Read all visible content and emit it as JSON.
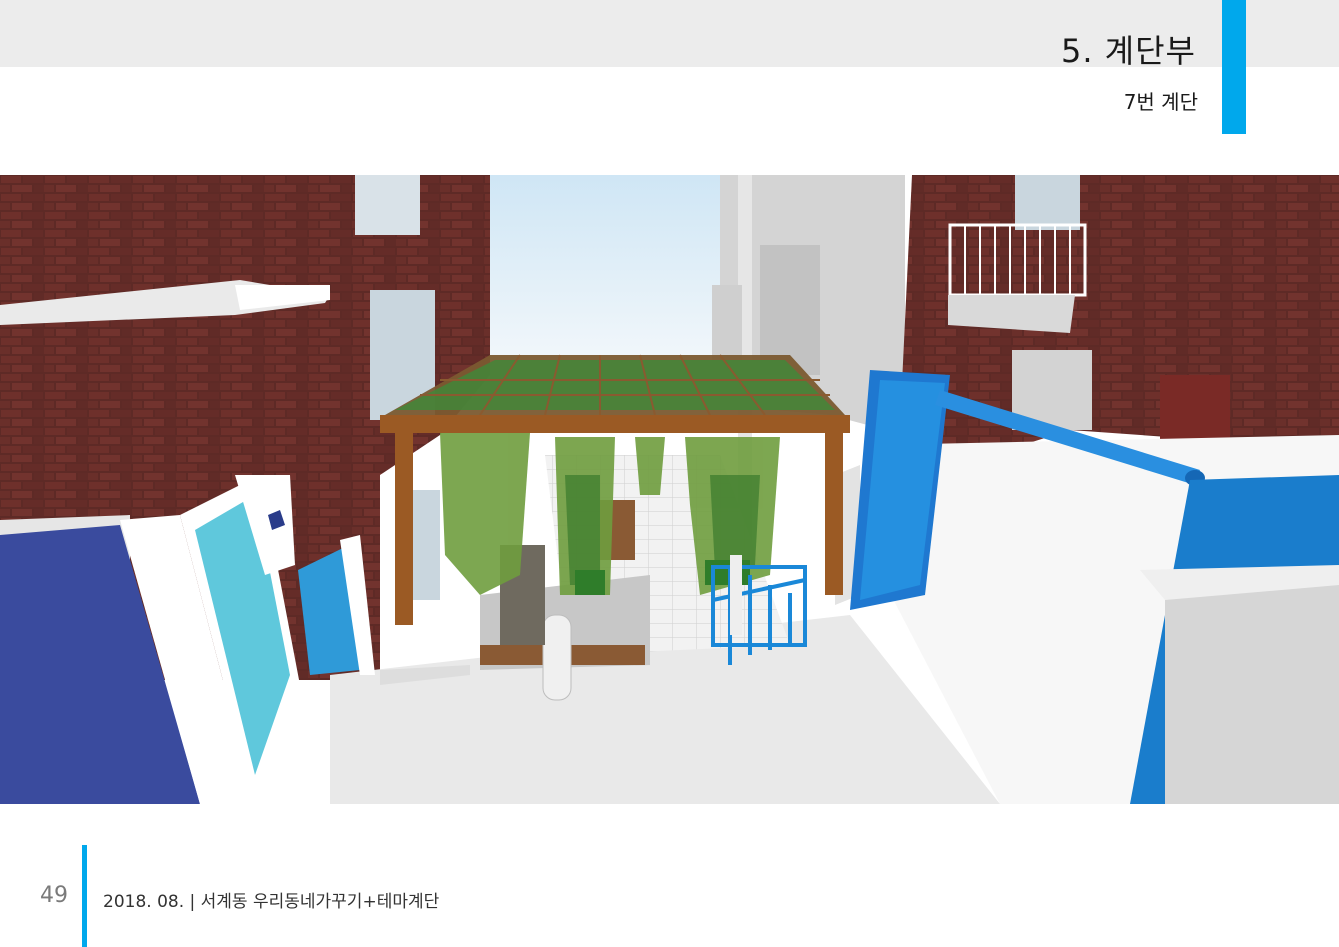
{
  "header": {
    "title": "5. 계단부",
    "subtitle": "7번 계단"
  },
  "figure": {
    "description_icon": "stairway-render-image"
  },
  "footer": {
    "page_number": "49",
    "text": "2018. 08.  |  서계동 우리동네가꾸기+테마계단"
  },
  "colors": {
    "accent": "#00a8ec",
    "header_band": "#ececec"
  }
}
